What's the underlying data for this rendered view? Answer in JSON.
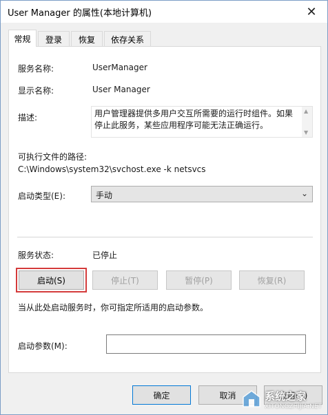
{
  "window": {
    "title": "User Manager 的属性(本地计算机)",
    "close_glyph": "✕"
  },
  "tabs": [
    {
      "label": "常规",
      "active": true
    },
    {
      "label": "登录",
      "active": false
    },
    {
      "label": "恢复",
      "active": false
    },
    {
      "label": "依存关系",
      "active": false
    }
  ],
  "general": {
    "service_name_label": "服务名称:",
    "service_name_value": "UserManager",
    "display_name_label": "显示名称:",
    "display_name_value": "User Manager",
    "description_label": "描述:",
    "description_value": "用户管理器提供多用户交互所需要的运行时组件。如果停止此服务，某些应用程序可能无法正确运行。",
    "exe_path_label": "可执行文件的路径:",
    "exe_path_value": "C:\\Windows\\system32\\svchost.exe -k netsvcs",
    "startup_type_label": "启动类型(E):",
    "startup_type_value": "手动",
    "service_status_label": "服务状态:",
    "service_status_value": "已停止"
  },
  "service_buttons": {
    "start": "启动(S)",
    "stop": "停止(T)",
    "pause": "暂停(P)",
    "resume": "恢复(R)"
  },
  "hint_text": "当从此处启动服务时，你可指定所适用的启动参数。",
  "start_params": {
    "label": "启动参数(M):",
    "value": ""
  },
  "footer": {
    "ok": "确定",
    "cancel": "取消",
    "apply": "应用(A)"
  },
  "watermark": {
    "text": "系统之家",
    "sub": "XITONGZHIJIA.NET"
  },
  "colors": {
    "highlight_frame": "#d43a3a",
    "primary_border": "#0078d7"
  },
  "icons": {
    "close": "close-icon",
    "dropdown": "chevron-down-icon",
    "scroll_up": "scroll-up-icon",
    "scroll_down": "scroll-down-icon"
  }
}
